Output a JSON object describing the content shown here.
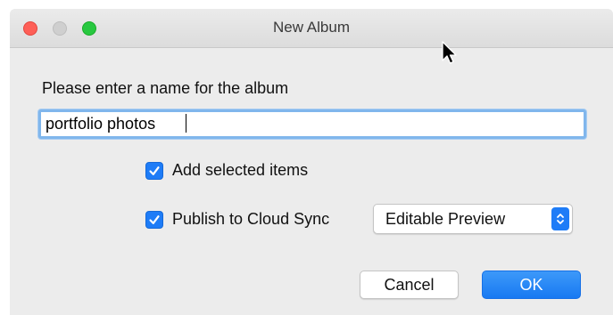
{
  "window": {
    "title": "New Album"
  },
  "dialog": {
    "prompt": "Please enter a name for the album",
    "name_value": "portfolio photos",
    "add_selected_label": "Add selected items",
    "add_selected_checked": true,
    "publish_label": "Publish to Cloud Sync",
    "publish_checked": true,
    "publish_option": "Editable Preview"
  },
  "buttons": {
    "cancel": "Cancel",
    "ok": "OK"
  },
  "colors": {
    "accent": "#1e7cf7",
    "close": "#fe5f57",
    "zoom": "#28c840"
  }
}
